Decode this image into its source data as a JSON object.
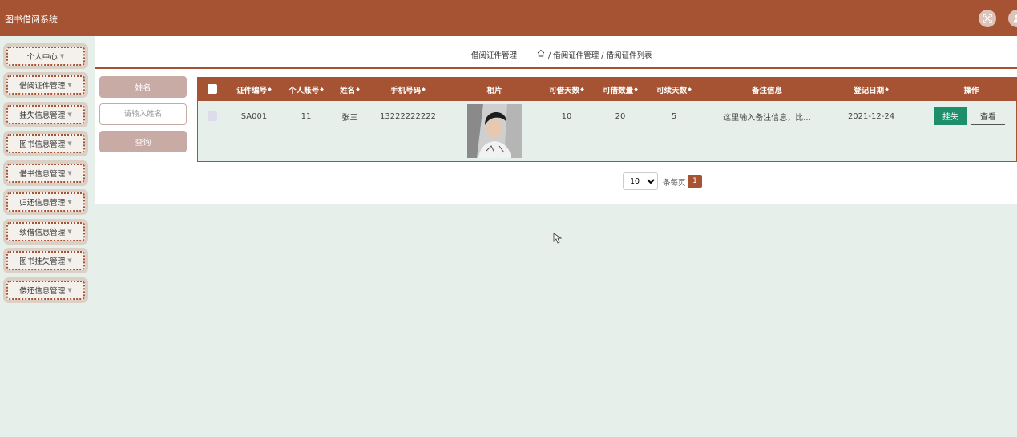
{
  "app": {
    "title": "图书借阅系统"
  },
  "icons": {
    "fullscreen": "fullscreen-icon",
    "user": "user-icon",
    "home": "home-icon",
    "caret": "caret-down-icon"
  },
  "colors": {
    "brand": "#a55332",
    "accent_green": "#1e8f6a",
    "background": "#e6efea"
  },
  "sidebar": {
    "items": [
      {
        "label": "个人中心"
      },
      {
        "label": "借阅证件管理"
      },
      {
        "label": "挂失信息管理"
      },
      {
        "label": "图书信息管理"
      },
      {
        "label": "借书信息管理"
      },
      {
        "label": "归还信息管理"
      },
      {
        "label": "续借信息管理"
      },
      {
        "label": "图书挂失管理"
      },
      {
        "label": "偿还信息管理"
      }
    ]
  },
  "breadcrumb": {
    "title": "借阅证件管理",
    "path": "/ 借阅证件管理 / 借阅证件列表"
  },
  "search": {
    "label": "姓名",
    "placeholder": "请输入姓名",
    "value": "",
    "button": "查询"
  },
  "table": {
    "columns": [
      "证件编号",
      "个人账号",
      "姓名",
      "手机号码",
      "相片",
      "可借天数",
      "可借数量",
      "可续天数",
      "备注信息",
      "登记日期",
      "操作"
    ],
    "rows": [
      {
        "cert_no": "SA001",
        "account": "11",
        "name": "张三",
        "phone": "13222222222",
        "loan_days": "10",
        "loan_qty": "20",
        "renew_days": "5",
        "remark": "这里输入备注信息，比...",
        "date": "2021-12-24",
        "action_report": "挂失",
        "action_view": "查看"
      }
    ]
  },
  "pagination": {
    "page_size": "10",
    "page_size_options": [
      "10"
    ],
    "per_page_text": "条每页",
    "current_page": "1"
  }
}
